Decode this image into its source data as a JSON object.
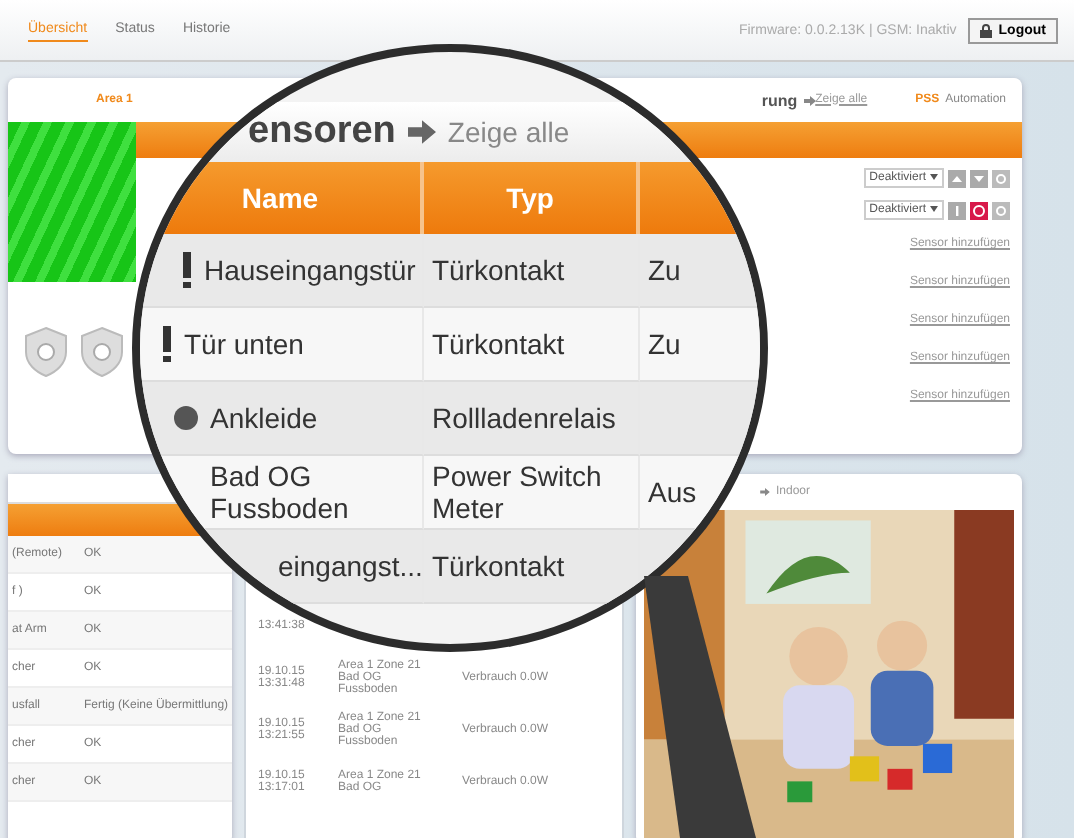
{
  "nav": {
    "tabs": [
      {
        "label": "Übersicht",
        "selected": true
      },
      {
        "label": "Status",
        "selected": false
      },
      {
        "label": "Historie",
        "selected": false
      }
    ],
    "firmware": "Firmware: 0.0.2.13K | GSM: Inaktiv",
    "logout": "Logout"
  },
  "sensor_panel": {
    "area": "Area 1",
    "heading": "rung",
    "show_all": "Zeige alle",
    "mode": "PSS",
    "automation": "Automation",
    "controls": [
      {
        "value": "Deaktiviert",
        "kind": "arrows"
      },
      {
        "value": "Deaktiviert",
        "kind": "alarm"
      }
    ],
    "links": [
      "Sensor hinzufügen",
      "Sensor hinzufügen",
      "Sensor hinzufügen",
      "Sensor hinzufügen",
      "Sensor hinzufügen"
    ]
  },
  "status_panel": {
    "rows": [
      {
        "name": "(Remote)",
        "status": "OK"
      },
      {
        "name": "f )",
        "status": "OK"
      },
      {
        "name": "at Arm",
        "status": "OK"
      },
      {
        "name": "cher",
        "status": "OK"
      },
      {
        "name": "usfall",
        "status": "Fertig (Keine Übermittlung)"
      },
      {
        "name": "cher",
        "status": "OK"
      },
      {
        "name": "cher",
        "status": "OK"
      }
    ]
  },
  "log_panel": {
    "rows": [
      {
        "time": "13:41:38"
      },
      {
        "time": "19.10.15 13:31:48",
        "zone": "Area 1 Zone 21 Bad OG Fussboden",
        "value": "Verbrauch 0.0W"
      },
      {
        "time": "19.10.15 13:21:55",
        "zone": "Area 1 Zone 21 Bad OG Fussboden",
        "value": "Verbrauch 0.0W"
      },
      {
        "time": "19.10.15 13:17:01",
        "zone": "Area 1 Zone 21 Bad OG",
        "value": "Verbrauch 0.0W"
      }
    ]
  },
  "camera_panel": {
    "label": "Indoor"
  },
  "magnifier": {
    "title": "ensoren",
    "show_all": "Zeige alle",
    "columns": [
      "Name",
      "Typ"
    ],
    "rows": [
      {
        "kind": "alert",
        "name": "Hauseingangstür",
        "type": "Türkontakt",
        "state": "Zu"
      },
      {
        "kind": "alert",
        "name": "Tür unten",
        "type": "Türkontakt",
        "state": "Zu"
      },
      {
        "kind": "dot",
        "name": "Ankleide",
        "type": "Rollladenrelais"
      },
      {
        "kind": "plain",
        "name": "Bad OG Fussboden",
        "type": "Power Switch Meter",
        "state": "Aus"
      },
      {
        "kind": "plain",
        "name": "eingangst...",
        "type": "Türkontakt"
      }
    ]
  }
}
